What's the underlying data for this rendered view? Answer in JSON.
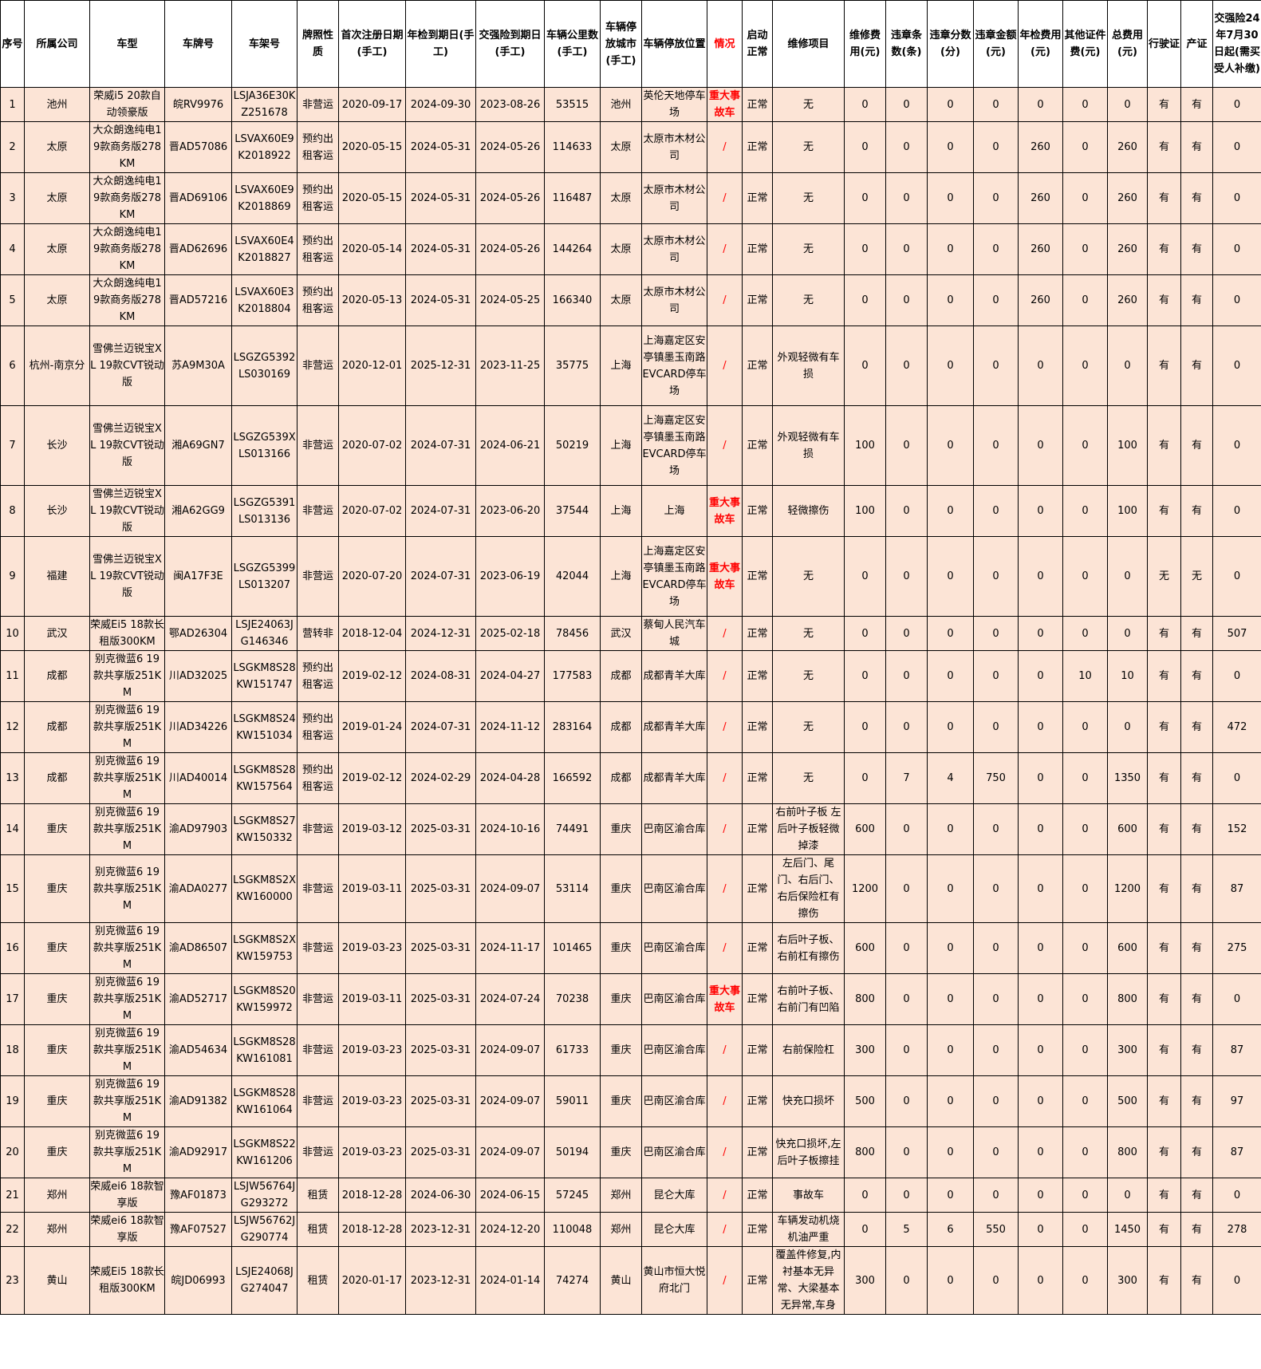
{
  "headers": [
    "序号",
    "所属公司",
    "车型",
    "车牌号",
    "车架号",
    "牌照性质",
    "首次注册日期(手工)",
    "年检到期日(手工)",
    "交强险到期日(手工)",
    "车辆公里数(手工)",
    "车辆停放城市(手工)",
    "车辆停放位置",
    "情况",
    "启动正常",
    "维修项目",
    "维修费用(元)",
    "违章条数(条)",
    "违章分数(分)",
    "违章金额(元)",
    "年检费用(元)",
    "其他证件费(元)",
    "总费用(元)",
    "行驶证",
    "产证",
    "交强险24年7月30日起(需买受人补缴)"
  ],
  "rows": [
    [
      "1",
      "池州",
      "荣威i5 20款自动领豪版",
      "皖RV9976",
      "LSJA36E30KZ251678",
      "非营运",
      "2020-09-17",
      "2024-09-30",
      "2023-08-26",
      "53515",
      "池州",
      "英伦天地停车场",
      "重大事故车",
      "正常",
      "无",
      "0",
      "0",
      "0",
      "0",
      "0",
      "0",
      "0",
      "有",
      "有",
      "0"
    ],
    [
      "2",
      "太原",
      "大众朗逸纯电19款商务版278KM",
      "晋AD57086",
      "LSVAX60E9K2018922",
      "预约出租客运",
      "2020-05-15",
      "2024-05-31",
      "2024-05-26",
      "114633",
      "太原",
      "太原市木材公司",
      "/",
      "正常",
      "无",
      "0",
      "0",
      "0",
      "0",
      "260",
      "0",
      "260",
      "有",
      "有",
      "0"
    ],
    [
      "3",
      "太原",
      "大众朗逸纯电19款商务版278KM",
      "晋AD69106",
      "LSVAX60E9K2018869",
      "预约出租客运",
      "2020-05-15",
      "2024-05-31",
      "2024-05-26",
      "116487",
      "太原",
      "太原市木材公司",
      "/",
      "正常",
      "无",
      "0",
      "0",
      "0",
      "0",
      "260",
      "0",
      "260",
      "有",
      "有",
      "0"
    ],
    [
      "4",
      "太原",
      "大众朗逸纯电19款商务版278KM",
      "晋AD62696",
      "LSVAX60E4K2018827",
      "预约出租客运",
      "2020-05-14",
      "2024-05-31",
      "2024-05-26",
      "144264",
      "太原",
      "太原市木材公司",
      "/",
      "正常",
      "无",
      "0",
      "0",
      "0",
      "0",
      "260",
      "0",
      "260",
      "有",
      "有",
      "0"
    ],
    [
      "5",
      "太原",
      "大众朗逸纯电19款商务版278KM",
      "晋AD57216",
      "LSVAX60E3K2018804",
      "预约出租客运",
      "2020-05-13",
      "2024-05-31",
      "2024-05-25",
      "166340",
      "太原",
      "太原市木材公司",
      "/",
      "正常",
      "无",
      "0",
      "0",
      "0",
      "0",
      "260",
      "0",
      "260",
      "有",
      "有",
      "0"
    ],
    [
      "6",
      "杭州-南京分",
      "雪佛兰迈锐宝XL 19款CVT锐动版",
      "苏A9M30A",
      "LSGZG5392LS030169",
      "非营运",
      "2020-12-01",
      "2025-12-31",
      "2023-11-25",
      "35775",
      "上海",
      "上海嘉定区安亭镇墨玉南路EVCARD停车场",
      "/",
      "正常",
      "外观轻微有车损",
      "0",
      "0",
      "0",
      "0",
      "0",
      "0",
      "0",
      "有",
      "有",
      "0"
    ],
    [
      "7",
      "长沙",
      "雪佛兰迈锐宝XL 19款CVT锐动版",
      "湘A69GN7",
      "LSGZG539XLS013166",
      "非营运",
      "2020-07-02",
      "2024-07-31",
      "2024-06-21",
      "50219",
      "上海",
      "上海嘉定区安亭镇墨玉南路EVCARD停车场",
      "/",
      "正常",
      "外观轻微有车损",
      "100",
      "0",
      "0",
      "0",
      "0",
      "0",
      "100",
      "有",
      "有",
      "0"
    ],
    [
      "8",
      "长沙",
      "雪佛兰迈锐宝XL 19款CVT锐动版",
      "湘A62GG9",
      "LSGZG5391LS013136",
      "非营运",
      "2020-07-02",
      "2024-07-31",
      "2023-06-20",
      "37544",
      "上海",
      "上海",
      "重大事故车",
      "正常",
      "轻微擦伤",
      "100",
      "0",
      "0",
      "0",
      "0",
      "0",
      "100",
      "有",
      "有",
      "0"
    ],
    [
      "9",
      "福建",
      "雪佛兰迈锐宝XL 19款CVT锐动版",
      "闽A17F3E",
      "LSGZG5399LS013207",
      "非营运",
      "2020-07-20",
      "2024-07-31",
      "2023-06-19",
      "42044",
      "上海",
      "上海嘉定区安亭镇墨玉南路EVCARD停车场",
      "重大事故车",
      "正常",
      "无",
      "0",
      "0",
      "0",
      "0",
      "0",
      "0",
      "0",
      "无",
      "无",
      "0"
    ],
    [
      "10",
      "武汉",
      "荣威Ei5 18款长租版300KM",
      "鄂AD26304",
      "LSJE24063JG146346",
      "营转非",
      "2018-12-04",
      "2024-12-31",
      "2025-02-18",
      "78456",
      "武汉",
      "蔡甸人民汽车城",
      "/",
      "正常",
      "无",
      "0",
      "0",
      "0",
      "0",
      "0",
      "0",
      "0",
      "有",
      "有",
      "507"
    ],
    [
      "11",
      "成都",
      "别克微蓝6 19款共享版251KM",
      "川AD32025",
      "LSGKM8S28KW151747",
      "预约出租客运",
      "2019-02-12",
      "2024-08-31",
      "2024-04-27",
      "177583",
      "成都",
      "成都青羊大库",
      "/",
      "正常",
      "无",
      "0",
      "0",
      "0",
      "0",
      "0",
      "10",
      "10",
      "有",
      "有",
      "0"
    ],
    [
      "12",
      "成都",
      "别克微蓝6 19款共享版251KM",
      "川AD34226",
      "LSGKM8S24KW151034",
      "预约出租客运",
      "2019-01-24",
      "2024-07-31",
      "2024-11-12",
      "283164",
      "成都",
      "成都青羊大库",
      "/",
      "正常",
      "无",
      "0",
      "0",
      "0",
      "0",
      "0",
      "0",
      "0",
      "有",
      "有",
      "472"
    ],
    [
      "13",
      "成都",
      "别克微蓝6 19款共享版251KM",
      "川AD40014",
      "LSGKM8S28KW157564",
      "预约出租客运",
      "2019-02-12",
      "2024-02-29",
      "2024-04-28",
      "166592",
      "成都",
      "成都青羊大库",
      "/",
      "正常",
      "无",
      "0",
      "7",
      "4",
      "750",
      "0",
      "0",
      "1350",
      "有",
      "有",
      "0"
    ],
    [
      "14",
      "重庆",
      "别克微蓝6 19款共享版251KM",
      "渝AD97903",
      "LSGKM8S27KW150332",
      "非营运",
      "2019-03-12",
      "2025-03-31",
      "2024-10-16",
      "74491",
      "重庆",
      "巴南区渝合库",
      "/",
      "正常",
      "右前叶子板 左后叶子板轻微掉漆",
      "600",
      "0",
      "0",
      "0",
      "0",
      "0",
      "600",
      "有",
      "有",
      "152"
    ],
    [
      "15",
      "重庆",
      "别克微蓝6 19款共享版251KM",
      "渝ADA0277",
      "LSGKM8S2XKW160000",
      "非营运",
      "2019-03-11",
      "2025-03-31",
      "2024-09-07",
      "53114",
      "重庆",
      "巴南区渝合库",
      "/",
      "正常",
      "左后门、尾门、右后门、右后保险杠有擦伤",
      "1200",
      "0",
      "0",
      "0",
      "0",
      "0",
      "1200",
      "有",
      "有",
      "87"
    ],
    [
      "16",
      "重庆",
      "别克微蓝6 19款共享版251KM",
      "渝AD86507",
      "LSGKM8S2XKW159753",
      "非营运",
      "2019-03-23",
      "2025-03-31",
      "2024-11-17",
      "101465",
      "重庆",
      "巴南区渝合库",
      "/",
      "正常",
      "右后叶子板、右前杠有擦伤",
      "600",
      "0",
      "0",
      "0",
      "0",
      "0",
      "600",
      "有",
      "有",
      "275"
    ],
    [
      "17",
      "重庆",
      "别克微蓝6 19款共享版251KM",
      "渝AD52717",
      "LSGKM8S20KW159972",
      "非营运",
      "2019-03-11",
      "2025-03-31",
      "2024-07-24",
      "70238",
      "重庆",
      "巴南区渝合库",
      "重大事故车",
      "正常",
      "右前叶子板、右前门有凹陷",
      "800",
      "0",
      "0",
      "0",
      "0",
      "0",
      "800",
      "有",
      "有",
      "0"
    ],
    [
      "18",
      "重庆",
      "别克微蓝6 19款共享版251KM",
      "渝AD54634",
      "LSGKM8S28KW161081",
      "非营运",
      "2019-03-23",
      "2025-03-31",
      "2024-09-07",
      "61733",
      "重庆",
      "巴南区渝合库",
      "/",
      "正常",
      "右前保险杠",
      "300",
      "0",
      "0",
      "0",
      "0",
      "0",
      "300",
      "有",
      "有",
      "87"
    ],
    [
      "19",
      "重庆",
      "别克微蓝6 19款共享版251KM",
      "渝AD91382",
      "LSGKM8S28KW161064",
      "非营运",
      "2019-03-23",
      "2025-03-31",
      "2024-09-07",
      "59011",
      "重庆",
      "巴南区渝合库",
      "/",
      "正常",
      "快充口损坏",
      "500",
      "0",
      "0",
      "0",
      "0",
      "0",
      "500",
      "有",
      "有",
      "97"
    ],
    [
      "20",
      "重庆",
      "别克微蓝6 19款共享版251KM",
      "渝AD92917",
      "LSGKM8S22KW161206",
      "非营运",
      "2019-03-23",
      "2025-03-31",
      "2024-09-07",
      "50194",
      "重庆",
      "巴南区渝合库",
      "/",
      "正常",
      "快充口损坏,左后叶子板擦挂",
      "800",
      "0",
      "0",
      "0",
      "0",
      "0",
      "800",
      "有",
      "有",
      "87"
    ],
    [
      "21",
      "郑州",
      "荣威ei6 18款智享版",
      "豫AF01873",
      "LSJW56764JG293272",
      "租赁",
      "2018-12-28",
      "2024-06-30",
      "2024-06-15",
      "57245",
      "郑州",
      "昆仑大库",
      "/",
      "正常",
      "事故车",
      "0",
      "0",
      "0",
      "0",
      "0",
      "0",
      "0",
      "有",
      "有",
      "0"
    ],
    [
      "22",
      "郑州",
      "荣威ei6 18款智享版",
      "豫AF07527",
      "LSJW56762JG290774",
      "租赁",
      "2018-12-28",
      "2023-12-31",
      "2024-12-20",
      "110048",
      "郑州",
      "昆仑大库",
      "/",
      "正常",
      "车辆发动机烧机油严重",
      "0",
      "5",
      "6",
      "550",
      "0",
      "0",
      "1450",
      "有",
      "有",
      "278"
    ],
    [
      "23",
      "黄山",
      "荣威Ei5 18款长租版300KM",
      "皖JD06993",
      "LSJE24068JG274047",
      "租赁",
      "2020-01-17",
      "2023-12-31",
      "2024-01-14",
      "74274",
      "黄山",
      "黄山市恒大悦府北门",
      "/",
      "正常",
      "覆盖件修复,内衬基本无异常、大梁基本无异常,车身",
      "300",
      "0",
      "0",
      "0",
      "0",
      "0",
      "300",
      "有",
      "有",
      "0"
    ]
  ]
}
